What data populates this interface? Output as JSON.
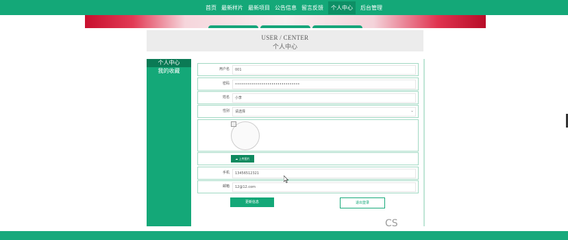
{
  "nav": {
    "items": [
      "首页",
      "最新样片",
      "最新项目",
      "公告信息",
      "留言反馈",
      "个人中心",
      "后台管理"
    ],
    "active_index": 5
  },
  "header": {
    "title_en": "USER / CENTER",
    "title_cn": "个人中心"
  },
  "sidebar": {
    "items": [
      "个人中心",
      "我的收藏"
    ]
  },
  "form": {
    "username": {
      "label": "用户名",
      "value": "001"
    },
    "password": {
      "label": "密码",
      "value": "••••••••••••••••••••••••••••••••"
    },
    "name": {
      "label": "姓名",
      "value": "小李"
    },
    "gender": {
      "label": "性别",
      "value": "请选择"
    },
    "upload_label": "上传图片",
    "phone": {
      "label": "手机",
      "value": "13456512321"
    },
    "email": {
      "label": "邮箱",
      "value": "12@12.com"
    }
  },
  "buttons": {
    "update": "更新信息",
    "logout": "退出登录"
  },
  "watermark": "CS",
  "colors": {
    "accent": "#14a878",
    "dark": "#0b7a55"
  }
}
